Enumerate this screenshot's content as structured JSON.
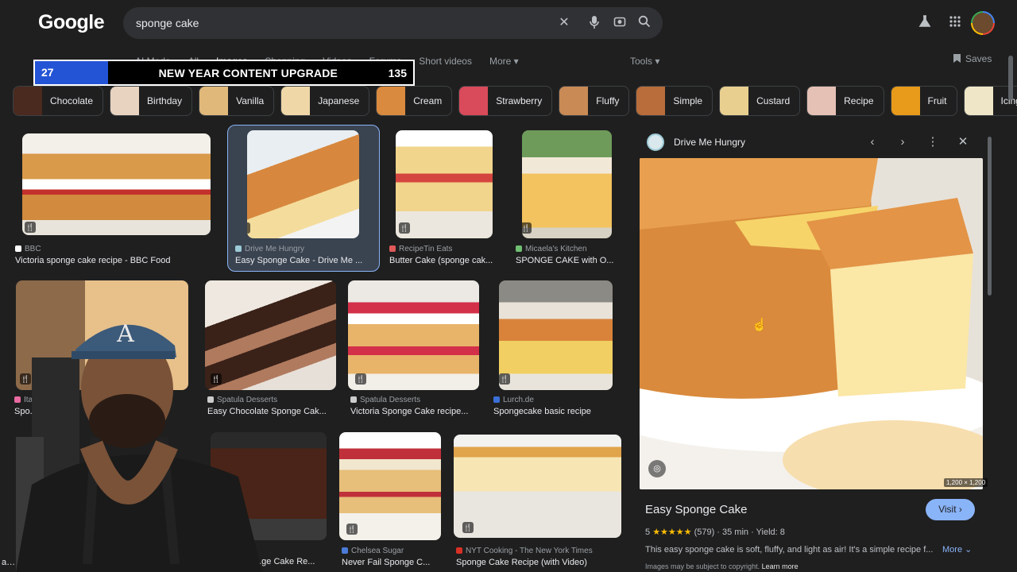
{
  "header": {
    "logo": "Google",
    "query": "sponge cake",
    "clear_icon": "close-icon",
    "voice_icon": "mic-icon",
    "lens_icon": "camera-icon",
    "search_icon": "search-icon",
    "labs_icon": "flask-icon",
    "apps_icon": "grid-icon"
  },
  "nav": {
    "tabs": [
      "AI Mode",
      "All",
      "Images",
      "Shopping",
      "Videos",
      "Forums",
      "Short videos",
      "More ▾"
    ],
    "active": "Images",
    "tools": "Tools ▾",
    "saves": "Saves"
  },
  "banner": {
    "left_num": "27",
    "title": "NEW YEAR CONTENT UPGRADE",
    "right_num": "135"
  },
  "chips": [
    {
      "label": "Chocolate",
      "color": "#4a2a1e"
    },
    {
      "label": "Birthday",
      "color": "#e8d3c0"
    },
    {
      "label": "Vanilla",
      "color": "#e0b87a"
    },
    {
      "label": "Japanese",
      "color": "#f0d7a8"
    },
    {
      "label": "Cream",
      "color": "#d98a3e"
    },
    {
      "label": "Strawberry",
      "color": "#d94a5a"
    },
    {
      "label": "Fluffy",
      "color": "#c98a55"
    },
    {
      "label": "Simple",
      "color": "#b86d3b"
    },
    {
      "label": "Custard",
      "color": "#e8cf90"
    },
    {
      "label": "Recipe",
      "color": "#e5c0b5"
    },
    {
      "label": "Fruit",
      "color": "#e89a1a"
    },
    {
      "label": "Icing",
      "color": "#efe6c8"
    }
  ],
  "results": [
    {
      "source": "BBC",
      "title": "Victoria sponge cake recipe - BBC Food",
      "fav": "#ffffff"
    },
    {
      "source": "Drive Me Hungry",
      "title": "Easy Sponge Cake - Drive Me ...",
      "fav": "#9ccad6"
    },
    {
      "source": "RecipeTin Eats",
      "title": "Butter Cake (sponge cak...",
      "fav": "#e05a5a"
    },
    {
      "source": "Micaela's Kitchen",
      "title": "SPONGE CAKE with O...",
      "fav": "#6fbf73"
    },
    {
      "source": "Itali...",
      "title": "Spo...",
      "fav": "#e86aa0"
    },
    {
      "source": "Spatula Desserts",
      "title": "Easy Chocolate Sponge Cak...",
      "fav": "#cccccc"
    },
    {
      "source": "Spatula Desserts",
      "title": "Victoria Sponge Cake recipe...",
      "fav": "#cccccc"
    },
    {
      "source": "Lurch.de",
      "title": "Spongecake basic recipe",
      "fav": "#3b6fd8"
    },
    {
      "source": "",
      "title": "...ge Cake Re...",
      "fav": "#cccccc"
    },
    {
      "source": "Chelsea Sugar",
      "title": "Never Fail Sponge C...",
      "fav": "#4a7bd8"
    },
    {
      "source": "NYT Cooking - The New York Times",
      "title": "Sponge Cake Recipe (with Video)",
      "fav": "#d93025"
    },
    {
      "source": "",
      "title": "as...",
      "fav": "#cccccc"
    }
  ],
  "panel": {
    "site": "Drive Me Hungry",
    "dims": "1,200 × 1,200",
    "title": "Easy Sponge Cake",
    "visit": "Visit ›",
    "rating_num": "5",
    "stars": "★★★★★",
    "rating_rest": "(579) · 35 min · Yield: 8",
    "description": "This easy sponge cake is soft, fluffy, and light as air! It's a simple recipe f...",
    "more": "More ⌄",
    "copyright": "Images may be subject to copyright.",
    "learn_more": "Learn more"
  }
}
